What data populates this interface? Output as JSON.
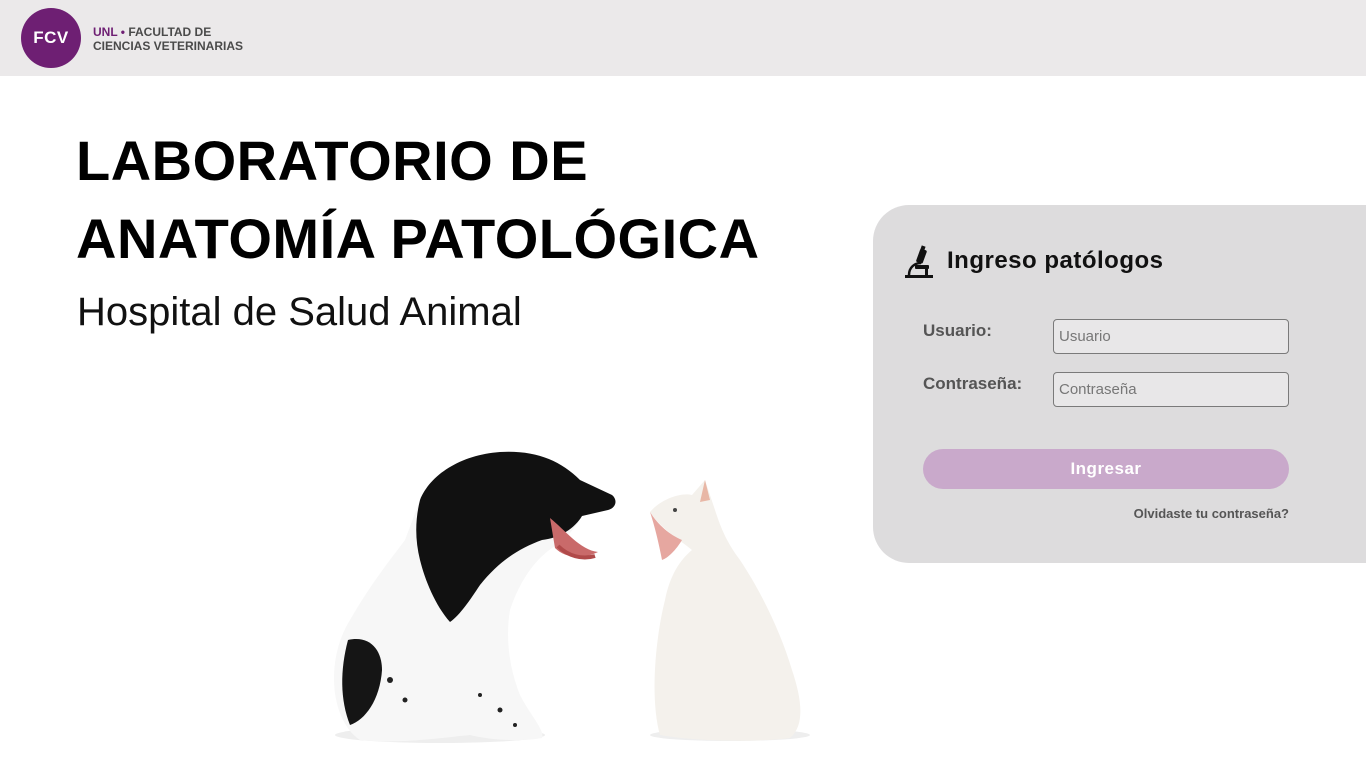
{
  "header": {
    "logo_initials": "FCV",
    "org_unl": "UNL",
    "org_separator": "•",
    "org_line1": "FACULTAD DE",
    "org_line2": "CIENCIAS VETERINARIAS"
  },
  "hero": {
    "title_line1": "LABORATORIO DE",
    "title_line2": "ANATOMÍA PATOLÓGICA",
    "subtitle": "Hospital de Salud Animal"
  },
  "login": {
    "icon": "microscope-icon",
    "title": "Ingreso patólogos",
    "username_label": "Usuario:",
    "username_placeholder": "Usuario",
    "password_label": "Contraseña:",
    "password_placeholder": "Contraseña",
    "submit_label": "Ingresar",
    "forgot_label": "Olvidaste tu contraseña?"
  },
  "colors": {
    "brand": "#6e1f73",
    "button": "#c9a9cb",
    "panel": "#dddcdd",
    "header_bg": "#ebe9ea"
  }
}
